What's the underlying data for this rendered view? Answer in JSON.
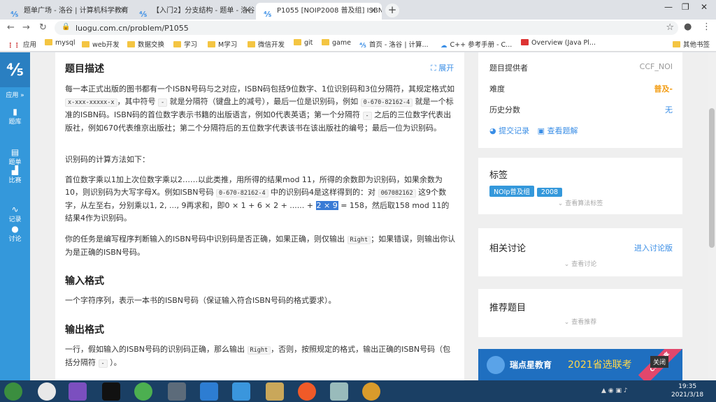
{
  "browser": {
    "tabs": [
      {
        "title": "题单广场 - 洛谷 | 计算机科学教育"
      },
      {
        "title": "【入门2】分支结构 - 题单 - 洛谷"
      },
      {
        "title": "P1055 [NOIP2008 普及组] ISBN"
      }
    ],
    "url": "luogu.com.cn/problem/P1055",
    "bookmarks": [
      "应用",
      "mysql",
      "web开发",
      "数据交换",
      "学习",
      "M学习",
      "微信开发",
      "git",
      "game",
      "首页 - 洛谷 | 计算...",
      "C++ 参考手册 - C...",
      "Overview (Java Pl...",
      "其他书签"
    ]
  },
  "sidebar": {
    "logo": "⅘",
    "apps_label": "应用 »",
    "items": [
      "题库",
      "题单",
      "比赛",
      "记录",
      "讨论"
    ]
  },
  "problem": {
    "section_desc": "题目描述",
    "expand": "展开",
    "p1a": "每一本正式出版的图书都有一个ISBN号码与之对应，ISBN码包括9位数字、1位识别码和3位分隔符，其规定格式如 ",
    "code_fmt": "x-xxx-xxxxx-x",
    "p1b": "，其中符号 ",
    "code_dash": "-",
    "p1c": " 就是分隔符（键盘上的减号），最后一位是识别码，例如 ",
    "code_ex": "0-670-82162-4",
    "p1d": " 就是一个标准的ISBN码。ISBN码的首位数字表示书籍的出版语言，例如0代表英语；第一个分隔符 ",
    "p1e": " 之后的三位数字代表出版社，例如670代表维京出版社；第二个分隔符后的五位数字代表该书在该出版社的编号；最后一位为识别码。",
    "p2": "识别码的计算方法如下：",
    "p3a": "首位数字乘以1加上次位数字乘以2……以此类推，用所得的结果mod 11，所得的余数即为识别码，如果余数为10，则识别码为大写字母X。例如ISBN号码 ",
    "p3b": " 中的识别码4是这样得到的：对 ",
    "code_digits": "067082162",
    "p3c": " 这9个数字，从左至右，分别乘以1, 2, ..., 9再求和，即0 × 1 + 6 × 2 + ...... + ",
    "p3sel": "2 × 9",
    "p3d": " = 158，然后取158 mod 11的结果4作为识别码。",
    "p4a": "你的任务是编写程序判断输入的ISBN号码中识别码是否正确，如果正确，则仅输出 ",
    "code_right": "Right",
    "p4b": "；如果错误，则输出你认为是正确的ISBN号码。",
    "section_input": "输入格式",
    "input_desc": "一个字符序列，表示一本书的ISBN号码（保证输入符合ISBN号码的格式要求）。",
    "section_output": "输出格式",
    "out_a": "一行，假如输入的ISBN号码的识别码正确，那么输出 ",
    "out_b": "，否则，按照规定的格式，输出正确的ISBN号码（包括分隔符 ",
    "out_c": " ）。"
  },
  "info": {
    "provider_label": "题目提供者",
    "provider": "CCF_NOI",
    "difficulty_label": "难度",
    "difficulty": "普及-",
    "history_label": "历史分数",
    "history": "无",
    "submit_record": "提交记录",
    "view_solution": "查看题解"
  },
  "tags": {
    "title": "标签",
    "items": [
      "NOIp普及组",
      "2008"
    ],
    "more": "查看算法标签"
  },
  "discuss": {
    "title": "相关讨论",
    "link": "进入讨论版",
    "more": "查看讨论"
  },
  "recommend": {
    "title": "推荐题目",
    "more": "查看推荐"
  },
  "banner": {
    "brand": "瑞点星教育",
    "year_text": "2021省选联考",
    "close": "关闭",
    "ribbon": "CCF 专享"
  },
  "taskbar": {
    "time": "19:35",
    "date": "2021/3/18"
  },
  "colors": {
    "accent": "#3498db",
    "difficulty": "#f39c12"
  }
}
